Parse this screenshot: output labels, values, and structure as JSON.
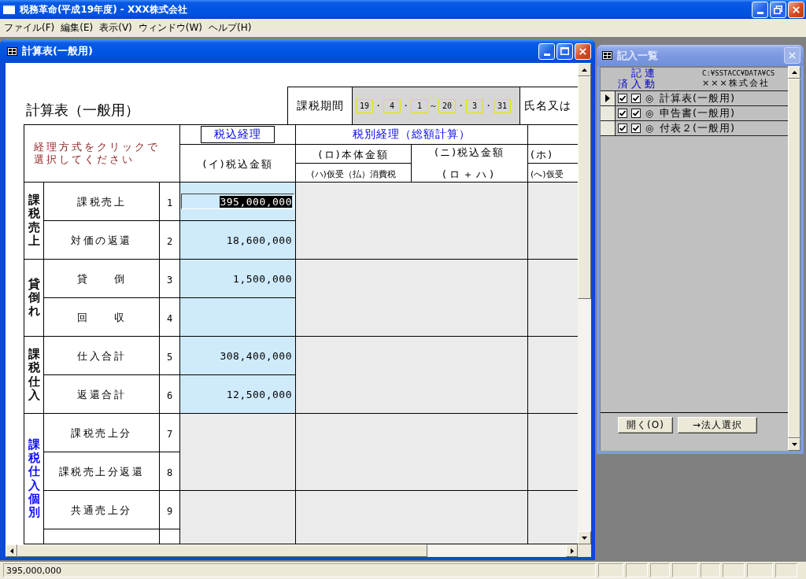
{
  "window": {
    "title": "税務革命(平成19年度) - XXX株式会社"
  },
  "menu": [
    "ファイル(F)",
    "編集(E)",
    "表示(V)",
    "ウィンドウ(W)",
    "ヘルプ(H)"
  ],
  "form_window": {
    "title": "計算表(一般用)",
    "active": true
  },
  "form": {
    "title": "計算表（一般用）",
    "period": {
      "label": "課税期間",
      "parts": [
        {
          "kind": "field",
          "text": "19"
        },
        {
          "kind": "sep",
          "text": "・"
        },
        {
          "kind": "field",
          "text": "4"
        },
        {
          "kind": "sep",
          "text": "・"
        },
        {
          "kind": "field",
          "text": "1"
        },
        {
          "kind": "sep",
          "text": "～"
        },
        {
          "kind": "field",
          "text": "20"
        },
        {
          "kind": "sep",
          "text": "・"
        },
        {
          "kind": "field",
          "text": "3"
        },
        {
          "kind": "sep",
          "text": "・"
        },
        {
          "kind": "field",
          "text": "31"
        }
      ]
    },
    "name_label": "氏名又は",
    "instruction": "経理方式をクリックで選択してください",
    "methods": [
      {
        "label": "税込経理",
        "selected": true
      },
      {
        "label": "税別経理（総額計算）",
        "selected": false
      }
    ],
    "columns": [
      {
        "kind": "single",
        "heading": "(イ)税込金額"
      },
      {
        "kind": "split",
        "heading": "(ロ)本体金額",
        "sub": "(ハ)仮受（払）消費税"
      },
      {
        "kind": "stacked",
        "heading": "(ニ)税込金額",
        "sub": "(ロ＋ハ)"
      },
      {
        "kind": "split",
        "heading": "(ホ)",
        "sub": "(へ)仮受"
      }
    ],
    "sections": [
      {
        "label": "課税売上",
        "color": "#000000",
        "rows": [
          {
            "no": "1",
            "label": "課税売上",
            "disabled": false,
            "value": "395,000,000",
            "selected": true
          },
          {
            "no": "2",
            "label": "対価の返還",
            "disabled": false,
            "value": "18,600,000",
            "selected": false
          }
        ]
      },
      {
        "label": "貸倒れ",
        "color": "#000000",
        "rows": [
          {
            "no": "3",
            "label": "貸　　倒",
            "disabled": false,
            "value": "1,500,000",
            "selected": false
          },
          {
            "no": "4",
            "label": "回　　収",
            "disabled": false,
            "selected": false
          }
        ]
      },
      {
        "label": "課税仕入",
        "color": "#000000",
        "rows": [
          {
            "no": "5",
            "label": "仕入合計",
            "disabled": false,
            "value": "308,400,000",
            "selected": false
          },
          {
            "no": "6",
            "label": "返還合計",
            "disabled": false,
            "value": "12,500,000",
            "selected": false
          }
        ]
      },
      {
        "label": "課税仕入個別",
        "color": "#0000ff",
        "rows": [
          {
            "no": "7",
            "label": "課税売上分",
            "disabled": true
          },
          {
            "no": "8",
            "label": "課税売上分返還",
            "disabled": true
          },
          {
            "no": "9",
            "label": "共通売上分",
            "disabled": true
          },
          {
            "disabled": true
          }
        ]
      }
    ]
  },
  "list_window": {
    "title": "記入一覧",
    "active": false,
    "columns": [
      "済",
      "記入",
      "連動"
    ],
    "path": "C:¥SSTACC¥DATA¥CS",
    "company": "×××株式会社",
    "rows": [
      {
        "selected": true,
        "done": true,
        "entered": true,
        "linked": "◎",
        "name": "計算表(一般用)"
      },
      {
        "selected": false,
        "done": true,
        "entered": true,
        "linked": "◎",
        "name": "申告書(一般用)"
      },
      {
        "selected": false,
        "done": true,
        "entered": true,
        "linked": "◎",
        "name": "付表２(一般用)"
      }
    ],
    "buttons": [
      "開く(O)",
      "→法人選択"
    ]
  },
  "status_bar": {
    "text": "395,000,000"
  }
}
